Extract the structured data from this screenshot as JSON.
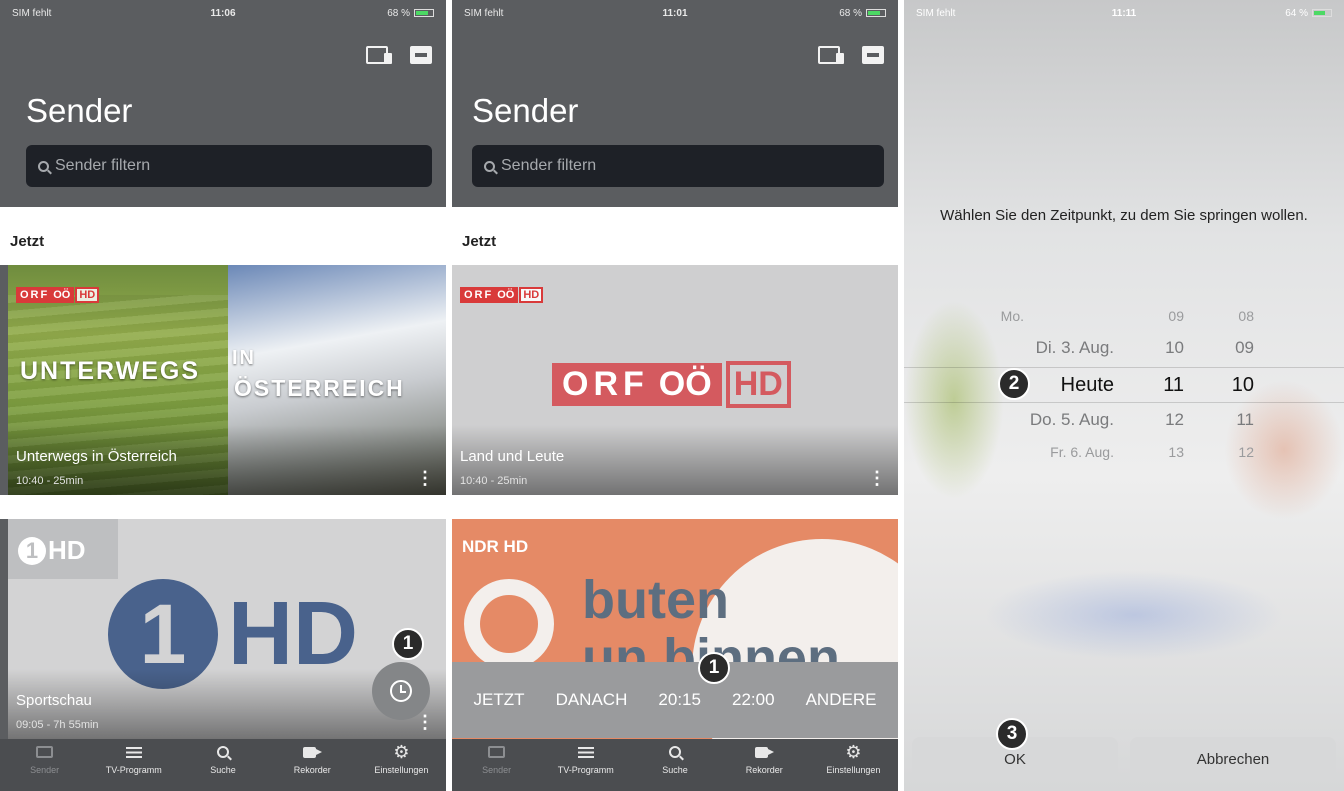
{
  "panels": [
    {
      "status": {
        "carrier": "SIM fehlt",
        "time": "11:06",
        "battery": "68 %"
      },
      "title": "Sender",
      "search_placeholder": "Sender filtern",
      "section": "Jetzt",
      "card1": {
        "logo": "ORF",
        "logo_oo": "OÖ",
        "logo_hd": "HD",
        "big1": "UNTERWEGS",
        "big2": "IN",
        "big3": "ÖSTERREICH",
        "title": "Unterwegs in Österreich",
        "time": "10:40 - 25min"
      },
      "card2": {
        "logo_hd": "HD",
        "big_hd": "HD",
        "title": "Sportschau",
        "time": "09:05 - 7h 55min"
      },
      "badge1": "1"
    },
    {
      "status": {
        "carrier": "SIM fehlt",
        "time": "11:01",
        "battery": "68 %"
      },
      "title": "Sender",
      "search_placeholder": "Sender filtern",
      "section": "Jetzt",
      "card1": {
        "logo": "ORF",
        "logo_oo": "OÖ",
        "logo_hd": "HD",
        "title": "Land und Leute",
        "time": "10:40 - 25min"
      },
      "card2": {
        "logo": "NDR HD",
        "text1": "buten",
        "text2": "un binnen"
      },
      "timebar": [
        "JETZT",
        "DANACH",
        "20:15",
        "22:00",
        "ANDERE"
      ],
      "badge1": "1"
    },
    {
      "status": {
        "carrier": "SIM fehlt",
        "time": "11:11",
        "battery": "64 %"
      },
      "prompt": "Wählen Sie den Zeitpunkt, zu dem Sie springen wollen.",
      "picker": {
        "days": [
          "Mo.",
          "Di. 3. Aug.",
          "Heute",
          "Do. 5. Aug.",
          "Fr. 6. Aug."
        ],
        "hours": [
          "09",
          "10",
          "11",
          "12",
          "13"
        ],
        "minutes": [
          "08",
          "09",
          "10",
          "11",
          "12"
        ]
      },
      "badge2": "2",
      "badge3": "3",
      "ok": "OK",
      "cancel": "Abbrechen"
    }
  ],
  "tabs": [
    "Sender",
    "TV-Programm",
    "Suche",
    "Rekorder",
    "Einstellungen"
  ],
  "colors": {
    "accent_red": "#d93a3a",
    "header_gray": "#5b5d60",
    "tabbar": "#4b4d50",
    "ard_blue": "#49628c",
    "ndr_orange": "#e58a66",
    "battery_green": "#4cd964"
  }
}
